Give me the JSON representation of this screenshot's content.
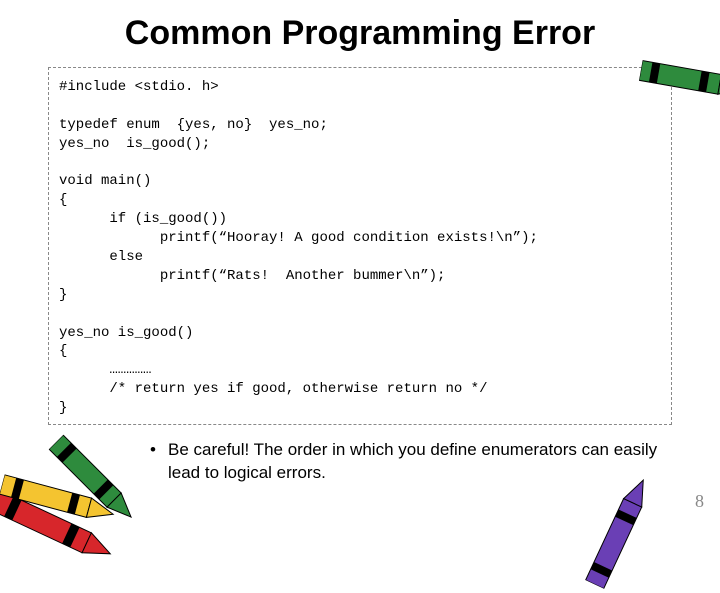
{
  "title": "Common Programming Error",
  "code": "#include <stdio. h>\n\ntypedef enum  {yes, no}  yes_no;\nyes_no  is_good();\n\nvoid main()\n{\n      if (is_good())\n            printf(“Hooray! A good condition exists!\\n”);\n      else\n            printf(“Rats!  Another bummer\\n”);\n}\n\nyes_no is_good()\n{\n      ……………\n      /* return yes if good, otherwise return no */\n}",
  "bullet": {
    "text": "Be careful!  The order in which you define enumerators can easily lead to logical errors."
  },
  "page_number": "8"
}
